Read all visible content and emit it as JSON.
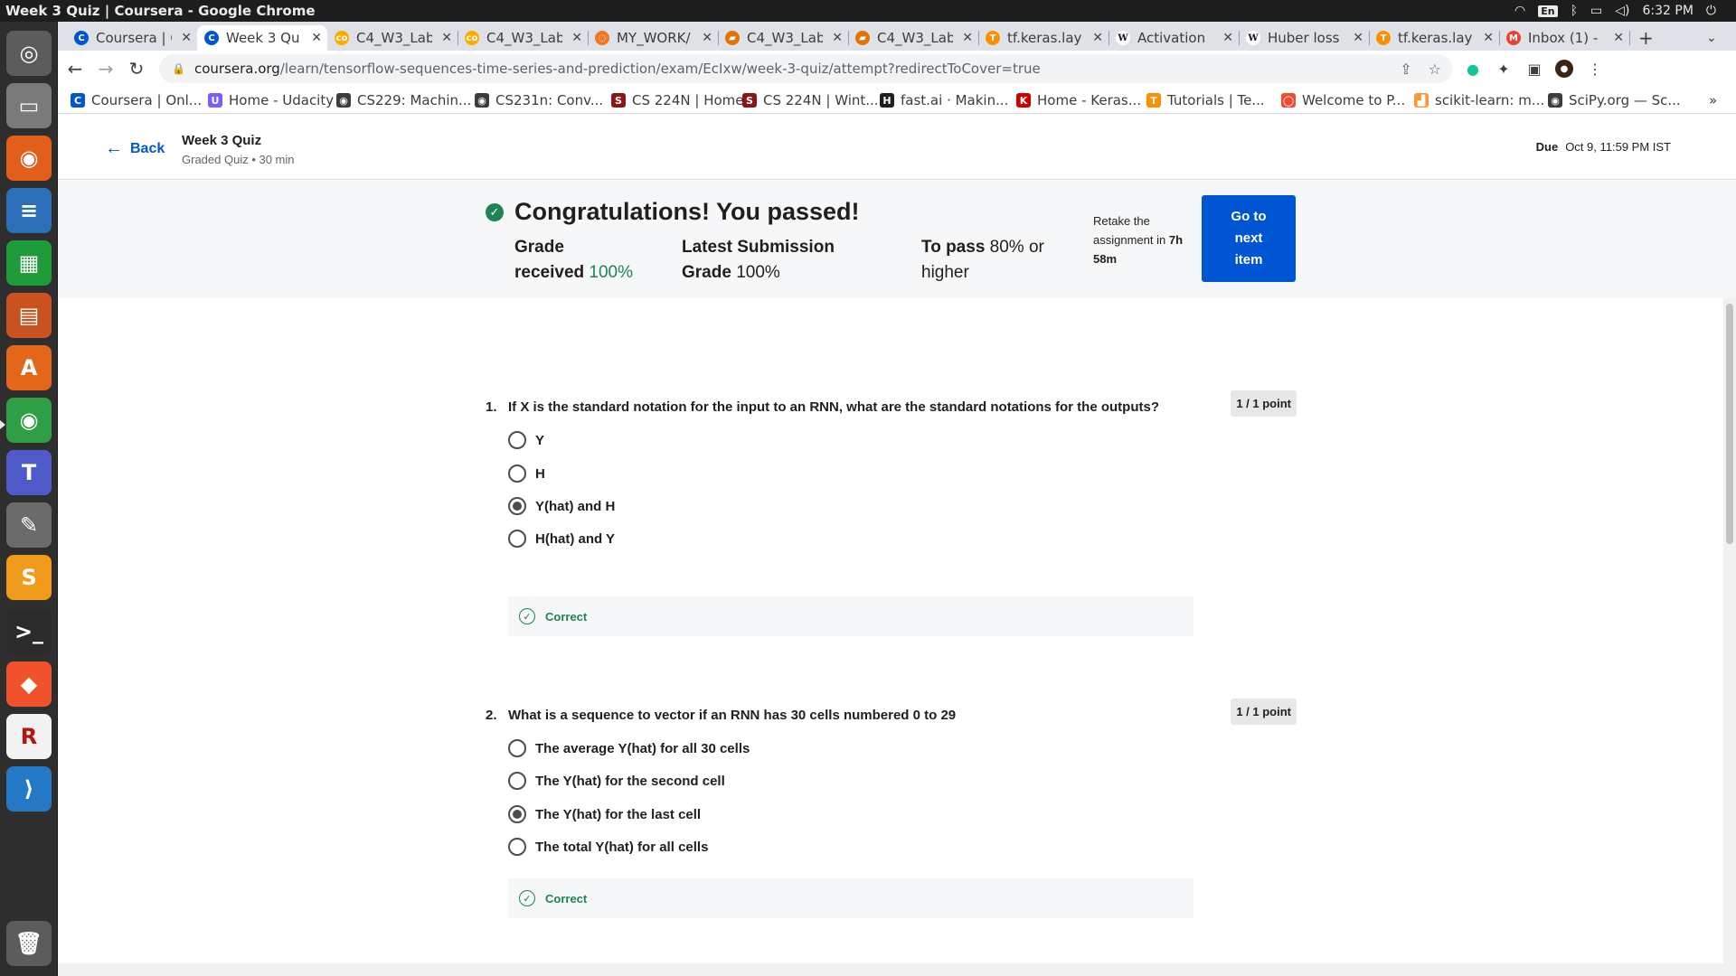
{
  "os": {
    "window_title": "Week 3 Quiz | Coursera - Google Chrome",
    "tray": {
      "lang": "En",
      "clock": "6:32 PM"
    }
  },
  "dock": {
    "items": [
      {
        "name": "dock-ubuntu-icon",
        "glyph": "◎",
        "color": "#5c5c5c"
      },
      {
        "name": "dock-files-icon",
        "glyph": "▭",
        "color": "#7a7a7a"
      },
      {
        "name": "dock-firefox-icon",
        "glyph": "◉",
        "color": "#e25f1b"
      },
      {
        "name": "dock-writer-icon",
        "glyph": "≡",
        "color": "#2a6fb8"
      },
      {
        "name": "dock-calc-icon",
        "glyph": "▦",
        "color": "#1e9c3a"
      },
      {
        "name": "dock-impress-icon",
        "glyph": "▤",
        "color": "#c9521e"
      },
      {
        "name": "dock-software-icon",
        "glyph": "A",
        "color": "#e3661b"
      },
      {
        "name": "dock-chrome-icon",
        "glyph": "◉",
        "color": "#2f9e44"
      },
      {
        "name": "dock-teams-icon",
        "glyph": "T",
        "color": "#5059c9"
      },
      {
        "name": "dock-editor-icon",
        "glyph": "✎",
        "color": "#6b6b6b"
      },
      {
        "name": "dock-sublime-icon",
        "glyph": "S",
        "color": "#f09a1c"
      },
      {
        "name": "dock-terminal-icon",
        "glyph": ">_",
        "color": "#2b2b2b"
      },
      {
        "name": "dock-brave-icon",
        "glyph": "◆",
        "color": "#f0532b"
      },
      {
        "name": "dock-rstudio-icon",
        "glyph": "R",
        "color": "#f2f2f2"
      },
      {
        "name": "dock-vscode-icon",
        "glyph": "⟩",
        "color": "#2479c7"
      },
      {
        "name": "dock-trash-icon",
        "glyph": "🗑",
        "color": "#5c5c5c"
      }
    ]
  },
  "tabs": [
    {
      "label": "Coursera | C",
      "fav_color": "#0056d2",
      "fav": "C"
    },
    {
      "label": "Week 3 Qu",
      "fav_color": "#0056d2",
      "fav": "C",
      "active": true
    },
    {
      "label": "C4_W3_Lab",
      "fav_color": "#f9ab00",
      "fav": "co"
    },
    {
      "label": "C4_W3_Lab",
      "fav_color": "#f9ab00",
      "fav": "co"
    },
    {
      "label": "MY_WORK/",
      "fav_color": "#f37626",
      "fav": "◌"
    },
    {
      "label": "C4_W3_Lab",
      "fav_color": "#e37400",
      "fav": "▰"
    },
    {
      "label": "C4_W3_Lab",
      "fav_color": "#e37400",
      "fav": "▰"
    },
    {
      "label": "tf.keras.lay",
      "fav_color": "#ff8f00",
      "fav": "T"
    },
    {
      "label": "Activation",
      "fav_color": "#ffffff",
      "fav": "W"
    },
    {
      "label": "Huber loss",
      "fav_color": "#ffffff",
      "fav": "W"
    },
    {
      "label": "tf.keras.lay",
      "fav_color": "#ff8f00",
      "fav": "T"
    },
    {
      "label": "Inbox (1) -",
      "fav_color": "#ea4335",
      "fav": "M"
    }
  ],
  "toolbar": {
    "url_host": "coursera.org",
    "url_path": "/learn/tensorflow-sequences-time-series-and-prediction/exam/EcIxw/week-3-quiz/attempt?redirectToCover=true"
  },
  "bookmarks": [
    {
      "label": "Coursera | Onl...",
      "fav": "C",
      "color": "#0056d2"
    },
    {
      "label": "Home - Udacity",
      "fav": "U",
      "color": "#7a5cff"
    },
    {
      "label": "CS229: Machin...",
      "fav": "◉",
      "color": "#3c3c3c"
    },
    {
      "label": "CS231n: Conv...",
      "fav": "◉",
      "color": "#3c3c3c"
    },
    {
      "label": "CS 224N | Home",
      "fav": "S",
      "color": "#8c1515"
    },
    {
      "label": "CS 224N | Wint...",
      "fav": "S",
      "color": "#8c1515"
    },
    {
      "label": "fast.ai · Makin...",
      "fav": "H",
      "color": "#1f1f1f"
    },
    {
      "label": "Home - Keras...",
      "fav": "K",
      "color": "#d00000"
    },
    {
      "label": "Tutorials  |  Te...",
      "fav": "T",
      "color": "#ff8f00"
    },
    {
      "label": "Welcome to P...",
      "fav": "◯",
      "color": "#ee4c2c"
    },
    {
      "label": "scikit-learn: m...",
      "fav": "▟",
      "color": "#f89939"
    },
    {
      "label": "SciPy.org — Sc...",
      "fav": "◉",
      "color": "#3c3c3c"
    }
  ],
  "header": {
    "back_label": "Back",
    "quiz_title": "Week 3 Quiz",
    "quiz_subtitle": "Graded Quiz • 30 min",
    "due_label": "Due",
    "due_value": "Oct 9, 11:59 PM IST"
  },
  "result": {
    "headline": "Congratulations! You passed!",
    "grade_label_1": "Grade",
    "grade_label_2": "received",
    "grade_value": "100%",
    "latest_label": "Latest Submission",
    "latest_label_2": "Grade",
    "latest_value": "100%",
    "pass_label": "To pass",
    "pass_value": "80% or",
    "pass_value_2": "higher",
    "retake_text_1": "Retake the",
    "retake_text_2": "assignment in",
    "retake_time_1": "7h",
    "retake_time_2": "58m",
    "next_button_1": "Go to",
    "next_button_2": "next",
    "next_button_3": "item"
  },
  "questions": [
    {
      "number": "1.",
      "text": "If X is the standard notation for the input to an RNN, what are the standard notations for the outputs?",
      "points": "1 / 1 point",
      "options": [
        "Y",
        "H",
        "Y(hat) and H",
        "H(hat) and Y"
      ],
      "selected": 2,
      "feedback": "Correct"
    },
    {
      "number": "2.",
      "text": "What is a sequence to vector if an RNN has 30 cells numbered 0 to 29",
      "points": "1 / 1 point",
      "options": [
        "The average Y(hat) for all 30 cells",
        "The Y(hat) for the second cell",
        "The Y(hat) for the last cell",
        "The total Y(hat) for all cells"
      ],
      "selected": 2,
      "feedback": "Correct"
    }
  ],
  "colors": {
    "accent": "#0056d2",
    "success": "#1f8354",
    "banner_bg": "#f5f7f8"
  }
}
